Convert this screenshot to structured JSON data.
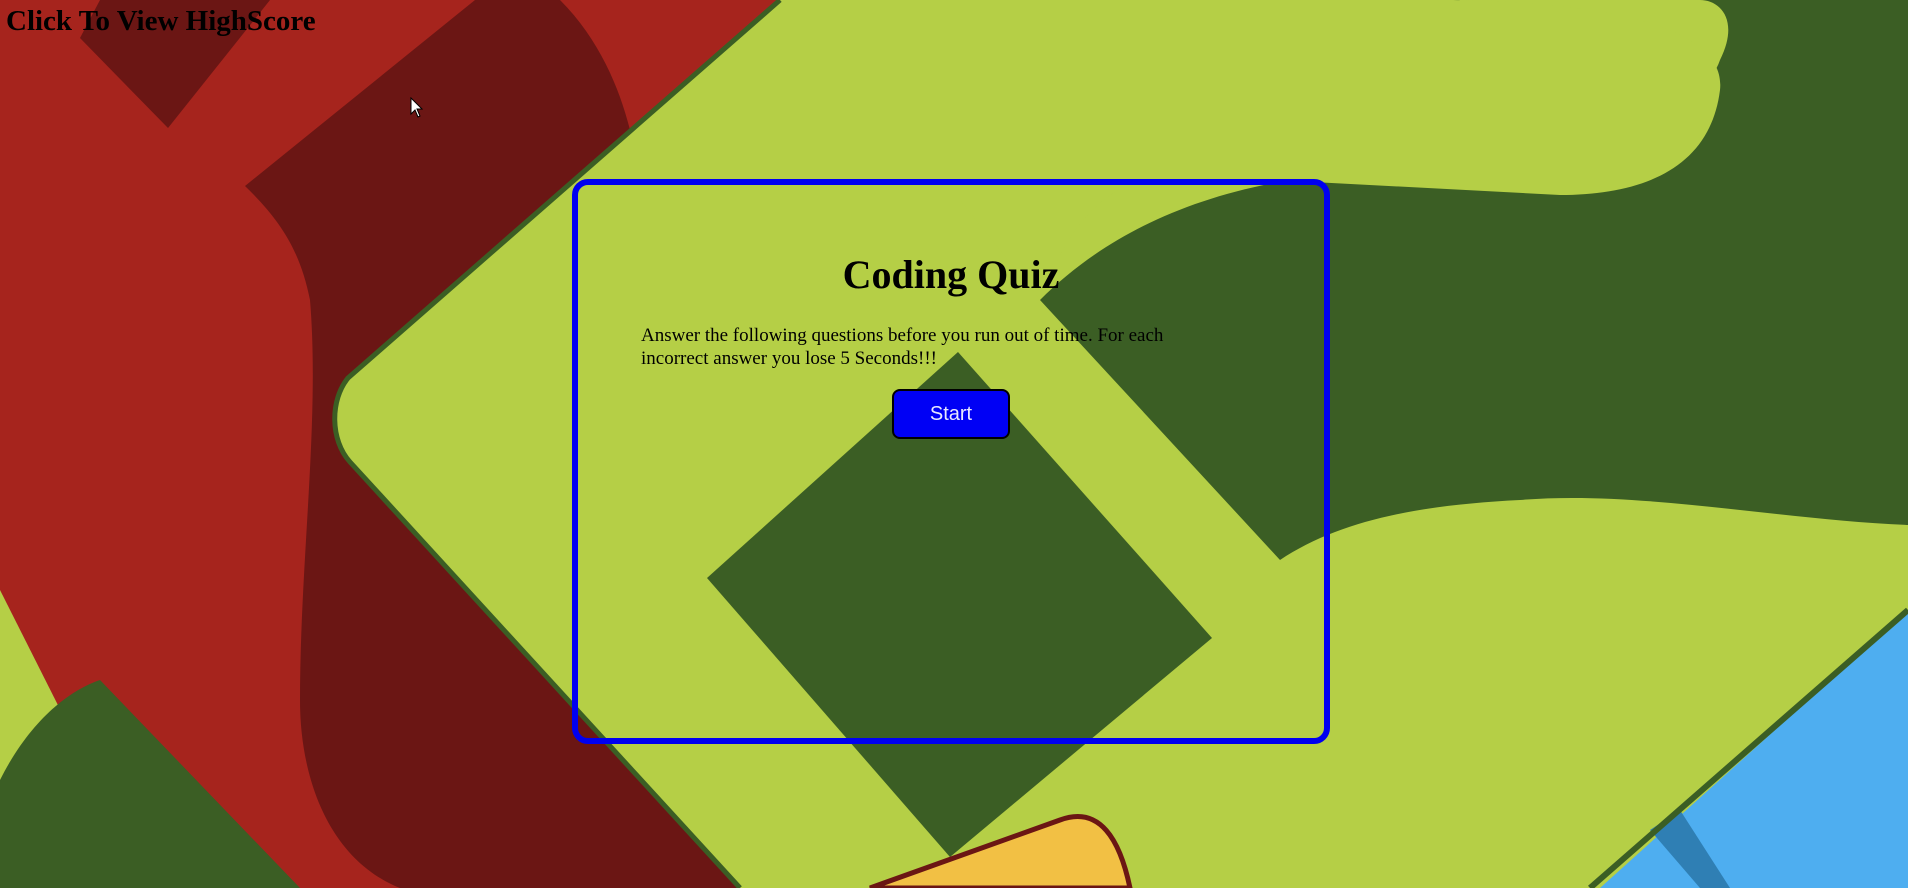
{
  "header": {
    "highscore_link": "Click To View HighScore"
  },
  "quiz": {
    "title": "Coding Quiz",
    "intro": "Answer the following questions before you run out of time. For each incorrect answer you lose 5 Seconds!!!",
    "start_label": "Start"
  },
  "colors": {
    "card_border": "#0000f0",
    "button_bg": "#0000f5",
    "button_text": "#e8e8ff",
    "wallpaper_red": "#a6241d",
    "wallpaper_dark_red": "#6b1614",
    "wallpaper_lime": "#b5cf46",
    "wallpaper_dark_green": "#3b5e24",
    "wallpaper_blue": "#4eaef0",
    "wallpaper_yellow": "#f2c044"
  },
  "icons": {
    "pointer": "mouse-pointer-icon"
  }
}
